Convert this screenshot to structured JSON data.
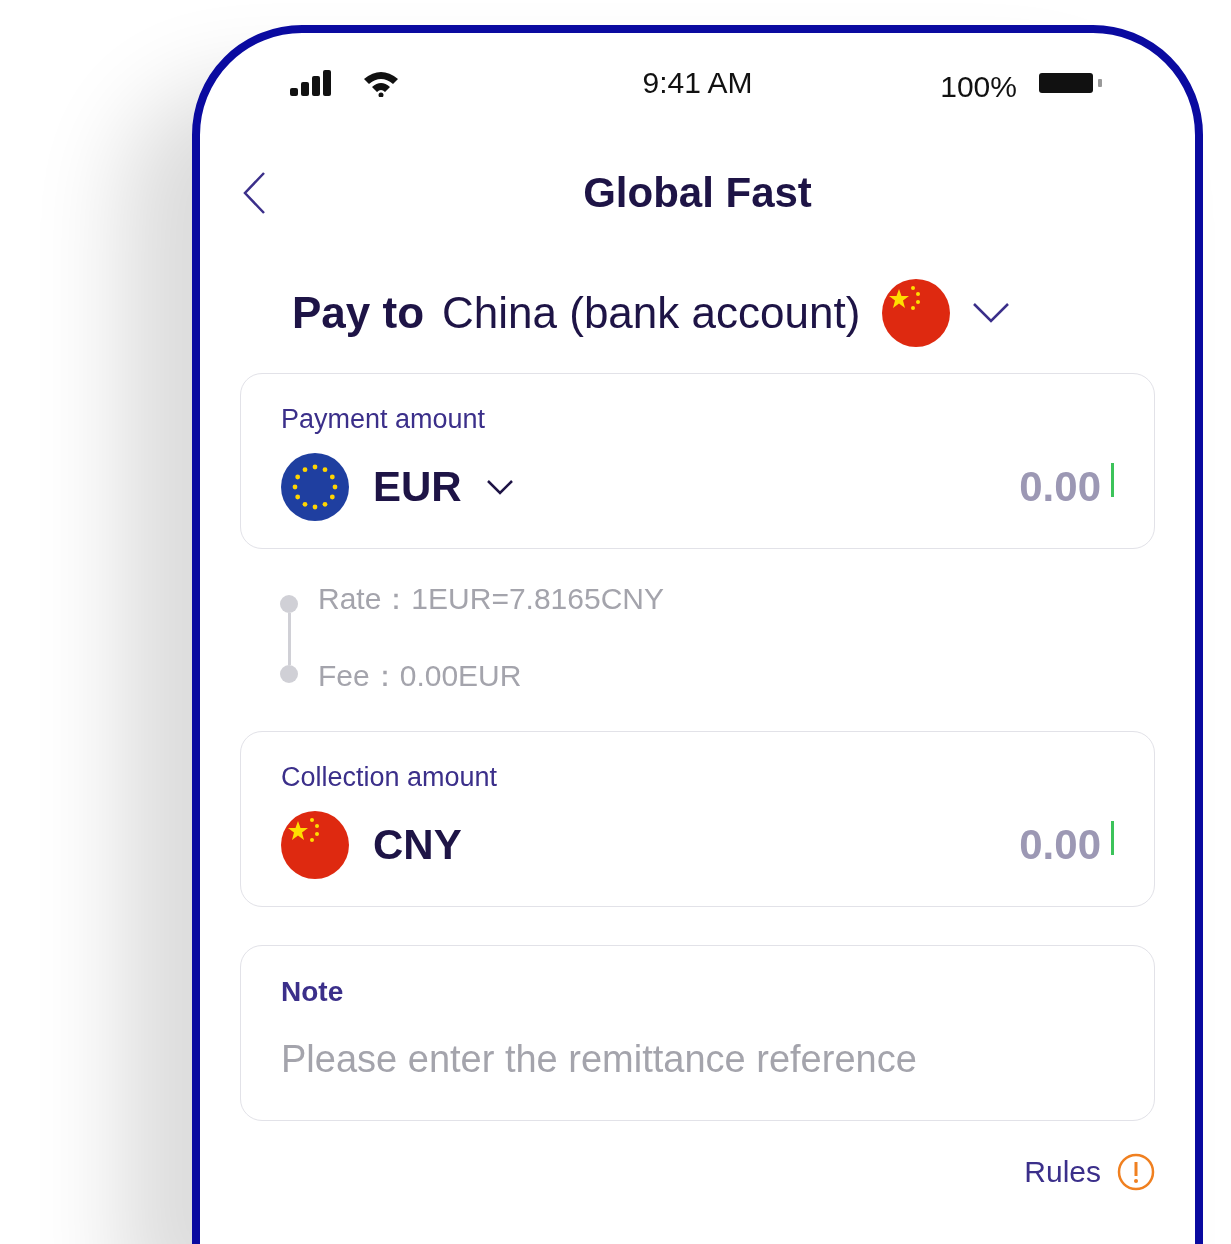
{
  "status_bar": {
    "time": "9:41 AM",
    "battery": "100%"
  },
  "header": {
    "title": "Global Fast"
  },
  "pay_to": {
    "label": "Pay to",
    "destination": "China (bank account)",
    "flag": {
      "kind": "cn"
    }
  },
  "payment": {
    "label": "Payment amount",
    "currency": "EUR",
    "flag": {
      "kind": "eu"
    },
    "dropdown": true,
    "amount": "0.00"
  },
  "rate_info": [
    "Rate：1EUR=7.8165CNY",
    "Fee：0.00EUR"
  ],
  "collection": {
    "label": "Collection amount",
    "currency": "CNY",
    "flag": {
      "kind": "cn"
    },
    "dropdown": false,
    "amount": "0.00"
  },
  "note": {
    "label": "Note",
    "placeholder": "Please enter the remittance reference"
  },
  "rules": {
    "label": "Rules"
  }
}
